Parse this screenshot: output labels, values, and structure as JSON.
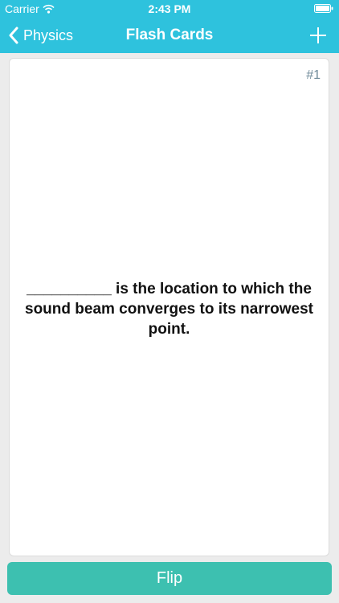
{
  "status_bar": {
    "carrier": "Carrier",
    "time": "2:43 PM",
    "wifi_icon": "wifi-icon",
    "battery_icon": "battery-icon"
  },
  "nav_bar": {
    "back_label": "Physics",
    "back_icon": "chevron-left-icon",
    "title": "Flash Cards",
    "add_icon": "plus-icon"
  },
  "card": {
    "number": "#1",
    "text": "__________ is the location to which the sound beam converges to its narrowest point."
  },
  "flip_button": {
    "label": "Flip"
  },
  "colors": {
    "header": "#2ec2dd",
    "flip_button": "#3dc0b0",
    "card_number": "#6f8a99",
    "background": "#ececec"
  }
}
